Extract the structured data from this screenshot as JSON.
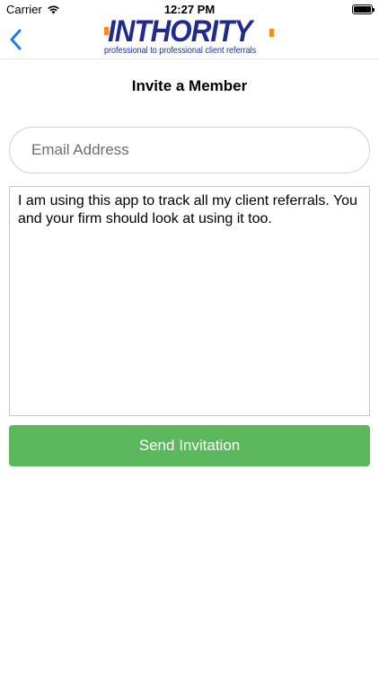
{
  "status_bar": {
    "carrier": "Carrier",
    "time": "12:27 PM",
    "wifi_icon": "wifi-icon",
    "battery_icon": "battery-icon"
  },
  "nav": {
    "back_icon": "chevron-left-icon",
    "logo_word": "INTHORITY",
    "logo_tagline": "professional to professional client referrals",
    "accent_color": "#1f2b8f",
    "brand_orange": "#f28c1e",
    "back_color": "#1a7cf5"
  },
  "page": {
    "title": "Invite a Member"
  },
  "form": {
    "email_placeholder": "Email Address",
    "email_value": "",
    "message_value": "I am using this app to track all my client referrals. You and your firm should look at using it too.",
    "send_label": "Send Invitation",
    "send_color": "#5cb85c"
  }
}
